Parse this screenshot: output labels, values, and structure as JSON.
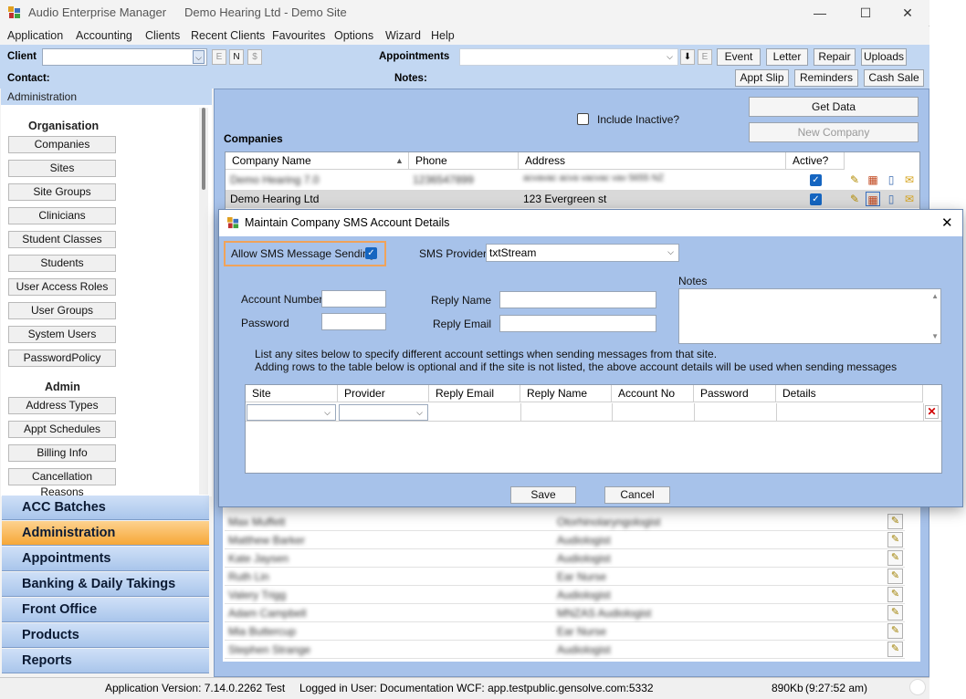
{
  "window": {
    "app_title": "Audio Enterprise Manager",
    "site_title": "Demo Hearing Ltd - Demo Site",
    "controls": {
      "minimize": "—",
      "maximize": "☐",
      "close": "✕"
    }
  },
  "menu": [
    "Application",
    "Accounting",
    "Clients",
    "Recent Clients",
    "Favourites",
    "Options",
    "Wizard",
    "Help"
  ],
  "toolbar": {
    "client_label": "Client",
    "contact_label": "Contact:",
    "appointments_label": "Appointments",
    "notes_label": "Notes:",
    "mini_e": "E",
    "mini_n": "N",
    "mini_dollar": "$",
    "mini_download": "⬇",
    "mini_e2": "E",
    "event": "Event",
    "letter": "Letter",
    "repair": "Repair",
    "uploads": "Uploads",
    "appt_slip": "Appt Slip",
    "reminders": "Reminders",
    "cash_sale": "Cash Sale"
  },
  "sidebar": {
    "header": "Administration",
    "organisation_title": "Organisation",
    "organisation_items": [
      "Companies",
      "Sites",
      "Site Groups",
      "Clinicians",
      "Student Classes",
      "Students",
      "User Access Roles",
      "User Groups",
      "System Users",
      "PasswordPolicy"
    ],
    "admin_title": "Admin",
    "admin_items": [
      "Address Types",
      "Appt Schedules",
      "Billing Info",
      "Cancellation Reasons"
    ],
    "nav": [
      "ACC Batches",
      "Administration",
      "Appointments",
      "Banking & Daily Takings",
      "Front Office",
      "Products",
      "Reports"
    ],
    "active_nav": "Administration"
  },
  "companies": {
    "title": "Companies",
    "include_inactive": "Include Inactive?",
    "get_data": "Get Data",
    "new_company": "New Company",
    "columns": [
      "Company Name",
      "Phone",
      "Address",
      "Active?"
    ],
    "rows": [
      {
        "name": "Demo Hearing 7.0",
        "phone": "1236547899",
        "address": "acvavac acva vacvac vav  5655 NZ",
        "active": true
      },
      {
        "name": "Demo Hearing Ltd",
        "phone": "",
        "address": "123 Evergreen st",
        "active": true
      }
    ]
  },
  "dialog": {
    "title": "Maintain Company SMS Account Details",
    "allow_sms_label": "Allow SMS Message Sending",
    "allow_sms_checked": true,
    "sms_provider_label": "SMS Provider",
    "sms_provider_value": "txtStream",
    "account_number_label": "Account Number",
    "password_label": "Password",
    "reply_name_label": "Reply Name",
    "reply_email_label": "Reply Email",
    "notes_label": "Notes",
    "info_line1": "List any sites below to specify different account settings when sending messages from that site.",
    "info_line2": "Adding rows to the table below is optional and if the site is not listed, the above account details will be used when sending messages",
    "columns": [
      "Site",
      "Provider",
      "Reply Email",
      "Reply Name",
      "Account No",
      "Password",
      "Details"
    ],
    "save": "Save",
    "cancel": "Cancel",
    "highlight_color": "#f0a35a"
  },
  "lower_list": [
    {
      "name": "Max Muffett",
      "role": "Otorhinolaryngologist"
    },
    {
      "name": "Matthew Barker",
      "role": "Audiologist"
    },
    {
      "name": "Kate Jaysen",
      "role": "Audiologist"
    },
    {
      "name": "Ruth Lin",
      "role": "Ear Nurse"
    },
    {
      "name": "Valery Trigg",
      "role": "Audiologist"
    },
    {
      "name": "Adam Campbell",
      "role": "MNZAS Audiologist"
    },
    {
      "name": "Mia Buttercup",
      "role": "Ear Nurse"
    },
    {
      "name": "Stephen Strange",
      "role": "Audiologist"
    }
  ],
  "status": {
    "version": "Application Version: 7.14.0.2262 Test",
    "user": "Logged in User: Documentation WCF: app.testpublic.gensolve.com:5332",
    "memory": "890Kb",
    "time": "(9:27:52 am)"
  },
  "colors": {
    "accent": "#f6a737",
    "panel": "#a7c2ea",
    "toolbar": "#c2d7f2",
    "check": "#1565c0"
  }
}
